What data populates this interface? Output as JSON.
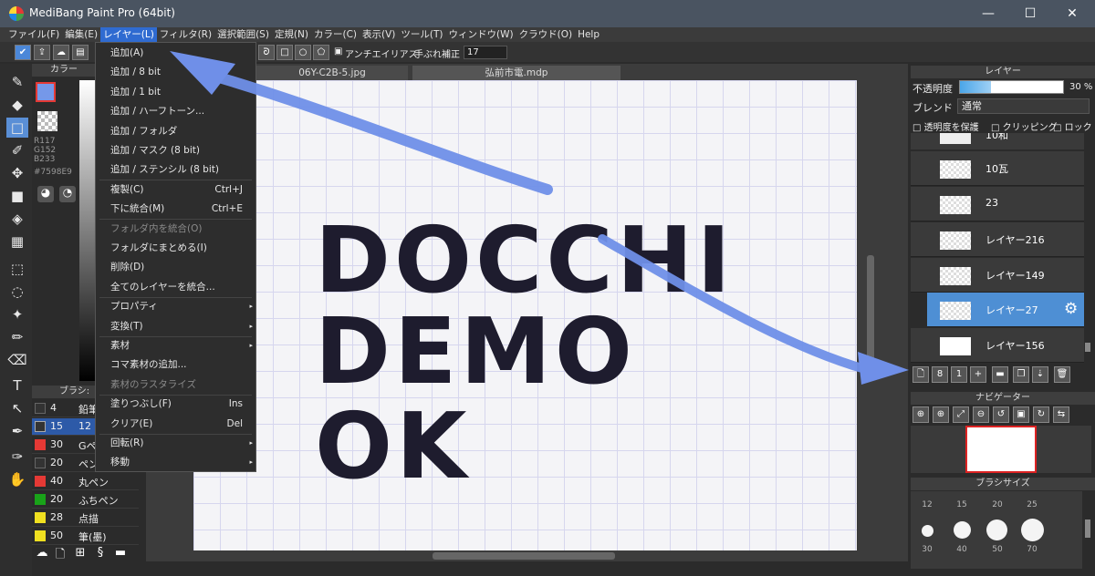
{
  "window": {
    "title": "MediBang Paint Pro (64bit)",
    "minimize": "—",
    "maximize": "☐",
    "close": "✕"
  },
  "menubar": [
    "ファイル(F)",
    "編集(E)",
    "レイヤー(L)",
    "フィルタ(R)",
    "選択範囲(S)",
    "定規(N)",
    "カラー(C)",
    "表示(V)",
    "ツール(T)",
    "ウィンドウ(W)",
    "クラウド(O)",
    "Help"
  ],
  "toolopts": {
    "antialias_label": "アンチエイリアス",
    "stabilizer_label": "手ぶれ補正",
    "stabilizer_value": "17"
  },
  "tabs": {
    "file1": "06Y-C2B-5.jpg",
    "file2": "弘前市電.mdp"
  },
  "color_panel": {
    "title": "カラー",
    "r": "R117",
    "g": "G152",
    "b": "B233",
    "hex": "#7598E9",
    "fg_color": "#7598e9"
  },
  "brush_panel": {
    "title": "ブラシ: ",
    "items": [
      {
        "num": "4",
        "name": "鉛筆",
        "color": "#333333"
      },
      {
        "num": "15",
        "name": "12",
        "color": "#333333"
      },
      {
        "num": "30",
        "name": "Gペン",
        "color": "#e53935"
      },
      {
        "num": "20",
        "name": "ペン",
        "color": "#333333"
      },
      {
        "num": "40",
        "name": "丸ペン",
        "color": "#e53935"
      },
      {
        "num": "20",
        "name": "ふちペン",
        "color": "#19a319"
      },
      {
        "num": "28",
        "name": "点描",
        "color": "#f0e020"
      },
      {
        "num": "50",
        "name": "筆(墨)",
        "color": "#f0e020"
      }
    ]
  },
  "canvas_text": {
    "line1": "DOCCHI",
    "line2": "DEMO",
    "line3": "OK"
  },
  "layer_menu": [
    {
      "label": "追加(A)",
      "shortcut": "",
      "disabled": false,
      "arrow": false
    },
    {
      "label": "追加 / 8 bit",
      "shortcut": "",
      "disabled": false,
      "arrow": false
    },
    {
      "label": "追加 / 1 bit",
      "shortcut": "",
      "disabled": false,
      "arrow": false
    },
    {
      "label": "追加 / ハーフトーン...",
      "shortcut": "",
      "disabled": false,
      "arrow": false
    },
    {
      "label": "追加 / フォルダ",
      "shortcut": "",
      "disabled": false,
      "arrow": false
    },
    {
      "label": "追加 / マスク (8 bit)",
      "shortcut": "",
      "disabled": false,
      "arrow": false
    },
    {
      "label": "追加 / ステンシル (8 bit)",
      "shortcut": "",
      "disabled": false,
      "arrow": false
    },
    {
      "label": "複製(C)",
      "shortcut": "Ctrl+J",
      "disabled": false,
      "arrow": false
    },
    {
      "label": "下に統合(M)",
      "shortcut": "Ctrl+E",
      "disabled": false,
      "arrow": false
    },
    {
      "label": "フォルダ内を統合(O)",
      "shortcut": "",
      "disabled": true,
      "arrow": false
    },
    {
      "label": "フォルダにまとめる(I)",
      "shortcut": "",
      "disabled": false,
      "arrow": false
    },
    {
      "label": "削除(D)",
      "shortcut": "",
      "disabled": false,
      "arrow": false
    },
    {
      "label": "全てのレイヤーを統合...",
      "shortcut": "",
      "disabled": false,
      "arrow": false
    },
    {
      "label": "プロパティ",
      "shortcut": "",
      "disabled": false,
      "arrow": true
    },
    {
      "label": "変換(T)",
      "shortcut": "",
      "disabled": false,
      "arrow": true
    },
    {
      "label": "素材",
      "shortcut": "",
      "disabled": false,
      "arrow": true
    },
    {
      "label": "コマ素材の追加...",
      "shortcut": "",
      "disabled": false,
      "arrow": false
    },
    {
      "label": "素材のラスタライズ",
      "shortcut": "",
      "disabled": true,
      "arrow": false
    },
    {
      "label": "塗りつぶし(F)",
      "shortcut": "Ins",
      "disabled": false,
      "arrow": false
    },
    {
      "label": "クリア(E)",
      "shortcut": "Del",
      "disabled": false,
      "arrow": false
    },
    {
      "label": "回転(R)",
      "shortcut": "",
      "disabled": false,
      "arrow": true
    },
    {
      "label": "移動",
      "shortcut": "",
      "disabled": false,
      "arrow": true
    }
  ],
  "layer_panel": {
    "title": "レイヤー",
    "opacity_label": "不透明度",
    "opacity_value": "30 %",
    "opacity": 0.3,
    "blend_label": "ブレンド",
    "blend_value": "通常",
    "protect_label": "透明度を保護",
    "clipping_label": "クリッピング",
    "lock_label": "ロック",
    "layers": [
      {
        "name": "10瓦",
        "selected": false
      },
      {
        "name": "23",
        "selected": false
      },
      {
        "name": "レイヤー216",
        "selected": false
      },
      {
        "name": "レイヤー149",
        "selected": false
      },
      {
        "name": "レイヤー27",
        "selected": true
      },
      {
        "name": "レイヤー156",
        "selected": false
      }
    ],
    "partial_top": "10和"
  },
  "navigator": {
    "title": "ナビゲーター"
  },
  "brush_size": {
    "title": "ブラシサイズ",
    "row1": [
      "12",
      "15",
      "20",
      "25"
    ],
    "row2": [
      "30",
      "40",
      "50",
      "70"
    ]
  }
}
